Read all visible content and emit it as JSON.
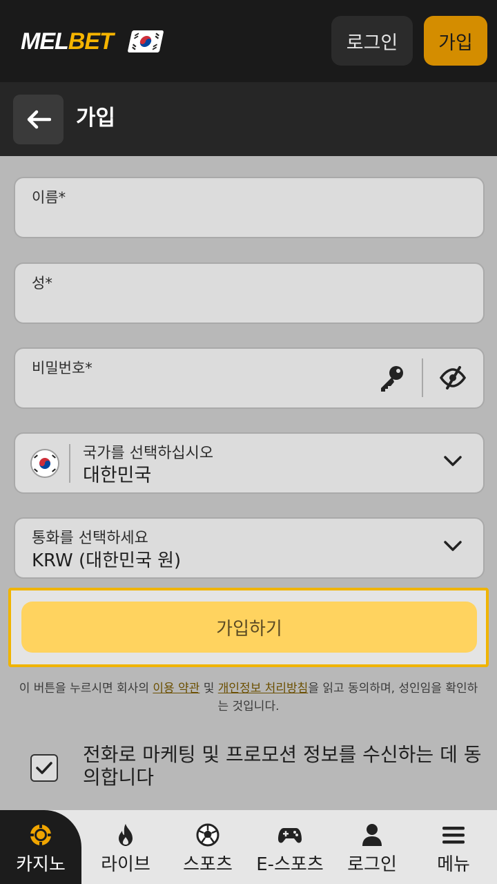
{
  "header": {
    "logo_part1": "MEL",
    "logo_part2": "BET",
    "login_label": "로그인",
    "register_label": "가입",
    "accent_color": "#d48d00"
  },
  "subheader": {
    "title": "가입"
  },
  "form": {
    "first_name_label": "이름*",
    "last_name_label": "성*",
    "password_label": "비밀번호*",
    "country_label": "국가를 선택하십시오",
    "country_value": "대한민국",
    "currency_label": "통화를 선택하세요",
    "currency_value": "KRW (대한민국 원)"
  },
  "submit": {
    "label": "가입하기",
    "color": "#ffd35f"
  },
  "terms": {
    "prefix": "이 버튼을 누르시면 회사의 ",
    "terms_link": "이용 약관",
    "middle": " 및 ",
    "privacy_link": "개인정보 처리방침",
    "suffix": "을 읽고 동의하며, 성인임을 확인하는 것입니다."
  },
  "marketing_consent": {
    "label": "전화로 마케팅 및 프로모션 정보를 수신하는 데 동의합니다",
    "checked": true
  },
  "bottom_nav": {
    "items": [
      {
        "label": "카지노",
        "icon": "casino-chip-icon"
      },
      {
        "label": "라이브",
        "icon": "flame-icon"
      },
      {
        "label": "스포츠",
        "icon": "soccer-ball-icon"
      },
      {
        "label": "E-스포츠",
        "icon": "gamepad-icon"
      },
      {
        "label": "로그인",
        "icon": "user-icon"
      },
      {
        "label": "메뉴",
        "icon": "hamburger-menu-icon"
      }
    ]
  }
}
